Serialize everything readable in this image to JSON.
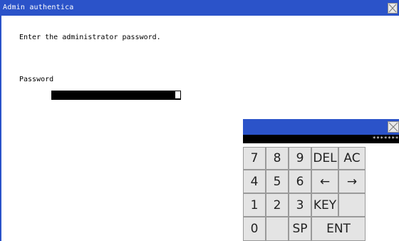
{
  "window": {
    "title": "Admin authentica",
    "close_icon": "close-icon"
  },
  "main": {
    "instruction": "Enter the administrator password.",
    "password_label": "Password"
  },
  "keypad": {
    "display_value": "*******",
    "close_icon": "close-icon",
    "keys": {
      "k7": "7",
      "k8": "8",
      "k9": "9",
      "del": "DEL",
      "ac": "AC",
      "k4": "4",
      "k5": "5",
      "k6": "6",
      "left": "←",
      "right": "→",
      "k1": "1",
      "k2": "2",
      "k3": "3",
      "key": "KEY",
      "k0": "0",
      "sp": "SP",
      "ent": "ENT"
    }
  },
  "colors": {
    "titlebar": "#2b53c9",
    "key_face": "#e4e4e4",
    "field": "#000000"
  }
}
